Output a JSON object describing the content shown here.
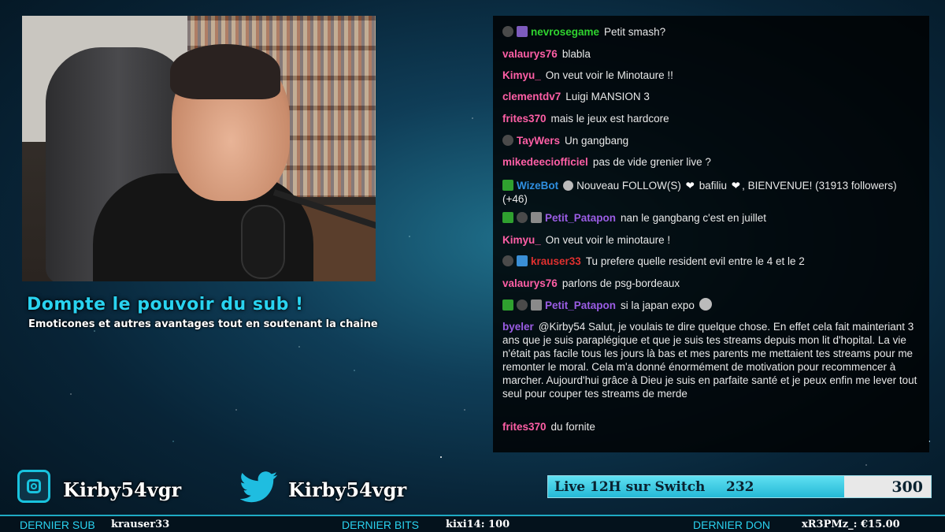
{
  "promo": {
    "title": "Dompte le pouvoir du sub !",
    "subtitle": "Emoticones et autres avantages tout en soutenant la chaine"
  },
  "chat": [
    {
      "user": "nevrosegame",
      "color": "#2fd32f",
      "text": "Petit smash?",
      "badges": [
        "dark",
        "sub"
      ]
    },
    {
      "user": "valaurys76",
      "color": "#ff5fa6",
      "text": "blabla",
      "badges": []
    },
    {
      "user": "Kimyu_",
      "color": "#ff5fa6",
      "text": "On veut voir le Minotaure !!",
      "badges": []
    },
    {
      "user": "clementdv7",
      "color": "#ff5fa6",
      "text": "Luigi MANSION 3",
      "badges": []
    },
    {
      "user": "frites370",
      "color": "#ff5fa6",
      "text": "mais le jeux est hardcore",
      "badges": []
    },
    {
      "user": "TayWers",
      "color": "#ff5fa6",
      "text": "Un gangbang",
      "badges": [
        "dark"
      ]
    },
    {
      "user": "mikedeeciofficiel",
      "color": "#ff5fa6",
      "text": "pas de vide grenier live ?",
      "badges": []
    },
    {
      "user": "WizeBot",
      "color": "#2f8fe0",
      "text_parts": [
        "Nouveau FOLLOW(S) ",
        "❤",
        " bafiliu ",
        "❤",
        ", BIENVENUE! (31913 followers) (+46)"
      ],
      "badges": [
        "mod"
      ]
    },
    {
      "user": "Petit_Patapon",
      "color": "#9b5de5",
      "text": "nan le gangbang c'est en juillet",
      "badges": [
        "mod",
        "dark",
        "gray"
      ]
    },
    {
      "user": "Kimyu_",
      "color": "#ff5fa6",
      "text": "On veut voir le minotaure !",
      "badges": []
    },
    {
      "user": "krauser33",
      "color": "#e0302f",
      "text": "Tu prefere quelle resident evil entre le 4 et le 2",
      "badges": [
        "dark",
        "blue"
      ]
    },
    {
      "user": "valaurys76",
      "color": "#ff5fa6",
      "text": "parlons de psg-bordeaux",
      "badges": []
    },
    {
      "user": "Petit_Patapon",
      "color": "#9b5de5",
      "text": "si la japan expo",
      "badges": [
        "mod",
        "dark",
        "gray"
      ]
    },
    {
      "user": "byeler",
      "color": "#9b5de5",
      "text": "@Kirby54 Salut, je voulais te dire quelque chose. En effet cela fait mainteriant 3 ans que je suis paraplégique et que je suis tes streams depuis mon lit d'hopital. La vie n'était pas facile tous les jours là bas et mes parents me mettaient tes streams pour me remonter le moral. Cela m'a donné énormément de motivation pour recommencer à marcher. Aujourd'hui grâce à Dieu je suis en parfaite santé et je peux enfin me lever tout seul pour couper tes streams de merde",
      "badges": []
    },
    {
      "user": "frites370",
      "color": "#ff5fa6",
      "text": "du fornite",
      "badges": []
    }
  ],
  "socials": {
    "instagram": "Kirby54vgr",
    "twitter": "Kirby54vgr"
  },
  "goal": {
    "label": "Live 12H sur Switch",
    "current": "232",
    "max": "300",
    "fraction": 0.773
  },
  "bottom": {
    "sub_label": "DERNIER SUB",
    "sub_value": "krauser33",
    "bits_label": "DERNIER BITS",
    "bits_value": "kixi14: 100",
    "don_label": "DERNIER DON",
    "don_value": "xR3PMz_: €15.00"
  }
}
